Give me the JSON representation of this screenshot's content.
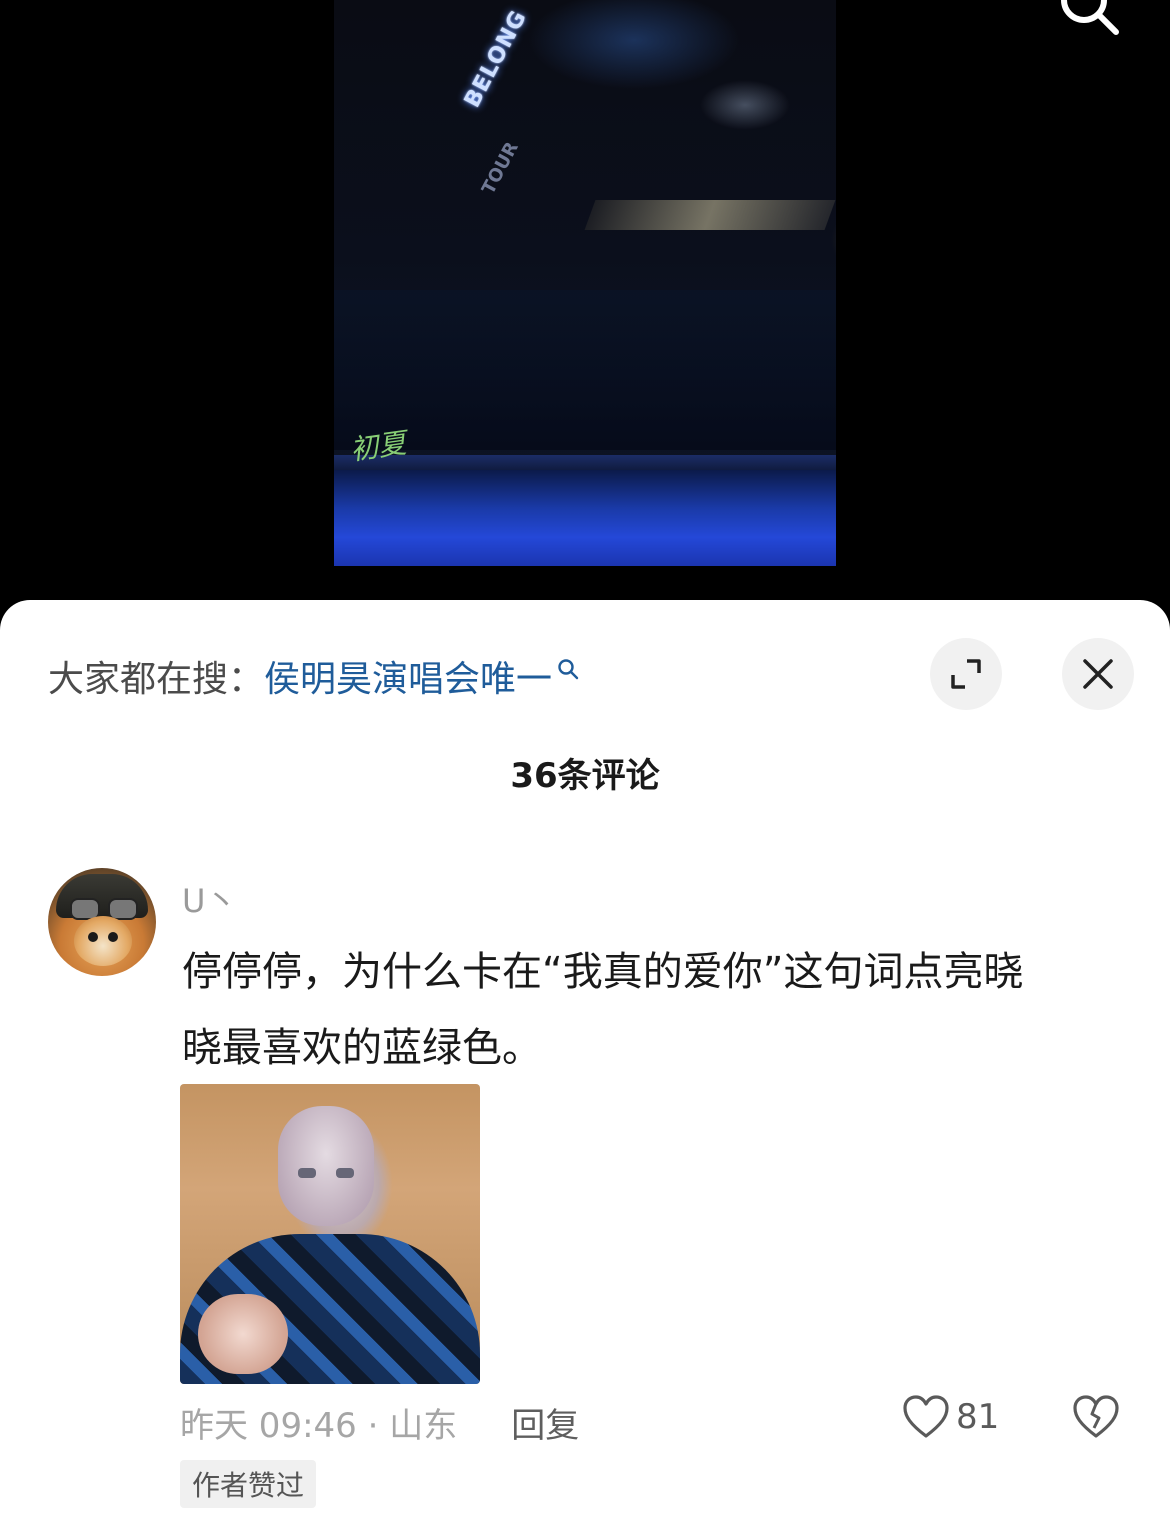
{
  "video": {
    "sign_line1": "BELONG",
    "sign_line2": "TOUR",
    "watermark": "初夏"
  },
  "sheet": {
    "hot_search_prefix": "大家都在搜：",
    "hot_search_query": "侯明昊演唱会唯一",
    "comment_count_label": "36条评论"
  },
  "comment": {
    "username": "U丶",
    "text": "停停停，为什么卡在“我真的爱你”这句词点亮晓\n晓最喜欢的蓝绿色。",
    "time_location": "昨天 09:46 · 山东",
    "reply_label": "回复",
    "like_count": "81",
    "author_badge": "作者赞过"
  },
  "icons": {
    "top_search": "search-icon",
    "hot_search": "search-icon",
    "expand": "expand-icon",
    "close": "close-icon",
    "like": "heart-icon",
    "dislike": "broken-heart-icon"
  },
  "colors": {
    "hot_search_link": "#1f5c9a",
    "sheet_bg": "#ffffff"
  }
}
